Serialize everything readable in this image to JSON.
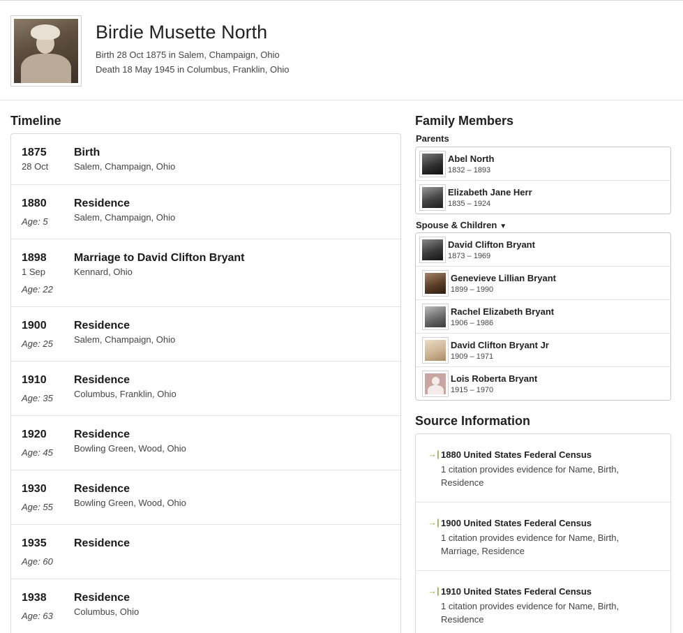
{
  "person": {
    "name": "Birdie Musette North",
    "birth": "Birth 28 Oct 1875 in Salem, Champaign, Ohio",
    "death": "Death 18 May 1945 in Columbus, Franklin, Ohio"
  },
  "timeline": {
    "title": "Timeline",
    "events": [
      {
        "year": "1875",
        "date": "28 Oct",
        "age": "",
        "event": "Birth",
        "place": "Salem, Champaign, Ohio"
      },
      {
        "year": "1880",
        "date": "",
        "age": "Age: 5",
        "event": "Residence",
        "place": "Salem, Champaign, Ohio"
      },
      {
        "year": "1898",
        "date": "1 Sep",
        "age": "Age: 22",
        "event": "Marriage to David Clifton Bryant",
        "place": "Kennard, Ohio"
      },
      {
        "year": "1900",
        "date": "",
        "age": "Age: 25",
        "event": "Residence",
        "place": "Salem, Champaign, Ohio"
      },
      {
        "year": "1910",
        "date": "",
        "age": "Age: 35",
        "event": "Residence",
        "place": "Columbus, Franklin, Ohio"
      },
      {
        "year": "1920",
        "date": "",
        "age": "Age: 45",
        "event": "Residence",
        "place": "Bowling Green, Wood, Ohio"
      },
      {
        "year": "1930",
        "date": "",
        "age": "Age: 55",
        "event": "Residence",
        "place": "Bowling Green, Wood, Ohio"
      },
      {
        "year": "1935",
        "date": "",
        "age": "Age: 60",
        "event": "Residence",
        "place": ""
      },
      {
        "year": "1938",
        "date": "",
        "age": "Age: 63",
        "event": "Residence",
        "place": "Columbus, Ohio"
      }
    ]
  },
  "family": {
    "title": "Family Members",
    "parents_label": "Parents",
    "spouse_label": "Spouse & Children",
    "parents": [
      {
        "name": "Abel North",
        "dates": "1832 – 1893"
      },
      {
        "name": "Elizabeth Jane Herr",
        "dates": "1835 – 1924"
      }
    ],
    "spouse_children": [
      {
        "name": "David Clifton Bryant",
        "dates": "1873 – 1969"
      },
      {
        "name": "Genevieve Lillian Bryant",
        "dates": "1899 – 1990"
      },
      {
        "name": "Rachel Elizabeth Bryant",
        "dates": "1906 – 1986"
      },
      {
        "name": "David Clifton Bryant Jr",
        "dates": "1909 – 1971"
      },
      {
        "name": "Lois Roberta Bryant",
        "dates": "1915 – 1970"
      }
    ]
  },
  "sources": {
    "title": "Source Information",
    "items": [
      {
        "title": "1880 United States Federal Census",
        "desc": "1 citation provides evidence for Name, Birth, Residence"
      },
      {
        "title": "1900 United States Federal Census",
        "desc": "1 citation provides evidence for Name, Birth, Marriage, Residence"
      },
      {
        "title": "1910 United States Federal Census",
        "desc": "1 citation provides evidence for Name, Birth, Residence"
      }
    ]
  }
}
